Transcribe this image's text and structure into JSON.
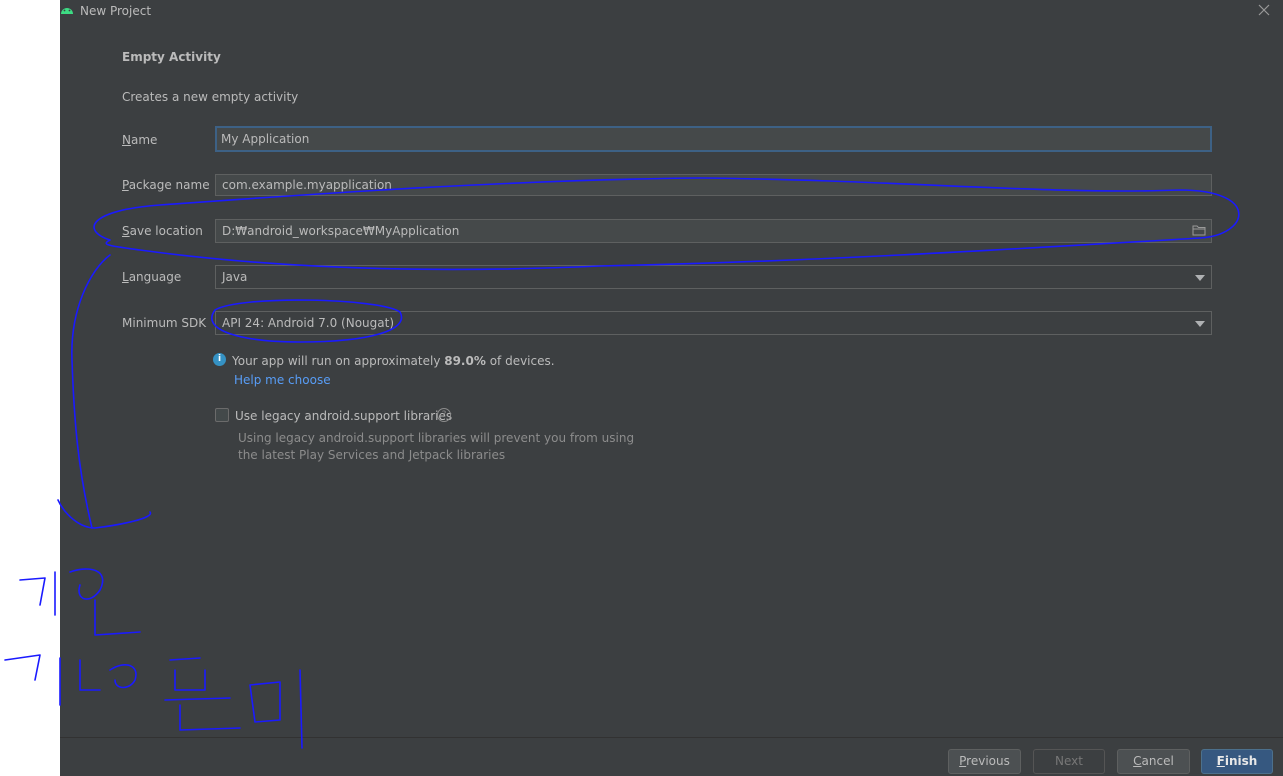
{
  "window": {
    "title": "New Project"
  },
  "page": {
    "heading": "Empty Activity",
    "description": "Creates a new empty activity"
  },
  "form": {
    "name": {
      "label_mnemonic": "N",
      "label_rest": "ame",
      "value": "My Application"
    },
    "package": {
      "label_mnemonic": "P",
      "label_rest": "ackage name",
      "value": "com.example.myapplication"
    },
    "save_location": {
      "label_mnemonic": "S",
      "label_rest": "ave location",
      "value": "D:₩android_workspace₩MyApplication"
    },
    "language": {
      "label_mnemonic": "L",
      "label_rest": "anguage",
      "value": "Java"
    },
    "min_sdk": {
      "label": "Minimum SDK",
      "value": "API 24: Android 7.0 (Nougat)"
    }
  },
  "info": {
    "text_before": "Your app will run on approximately ",
    "percent": "89.0%",
    "text_after": " of devices.",
    "help_link": "Help me choose"
  },
  "legacy": {
    "label": "Use legacy android.support libraries",
    "checked": false,
    "description": "Using legacy android.support libraries will prevent you from using the latest Play Services and Jetpack libraries"
  },
  "buttons": {
    "previous": {
      "mnemonic": "P",
      "rest": "revious"
    },
    "next": "Next",
    "cancel": {
      "mnemonic": "C",
      "rest": "ancel"
    },
    "finish": {
      "mnemonic": "F",
      "rest": "inish"
    }
  },
  "icons": {
    "app": "android-icon",
    "close": "close-icon",
    "folder": "folder-icon",
    "dropdown": "chevron-down-icon",
    "info": "info-icon",
    "help": "question-icon"
  },
  "colors": {
    "dialog_bg": "#3c3f41",
    "focus_border": "#3d6185",
    "link": "#589df6",
    "primary_button": "#365880",
    "annotation_ink": "#1a1aff"
  }
}
